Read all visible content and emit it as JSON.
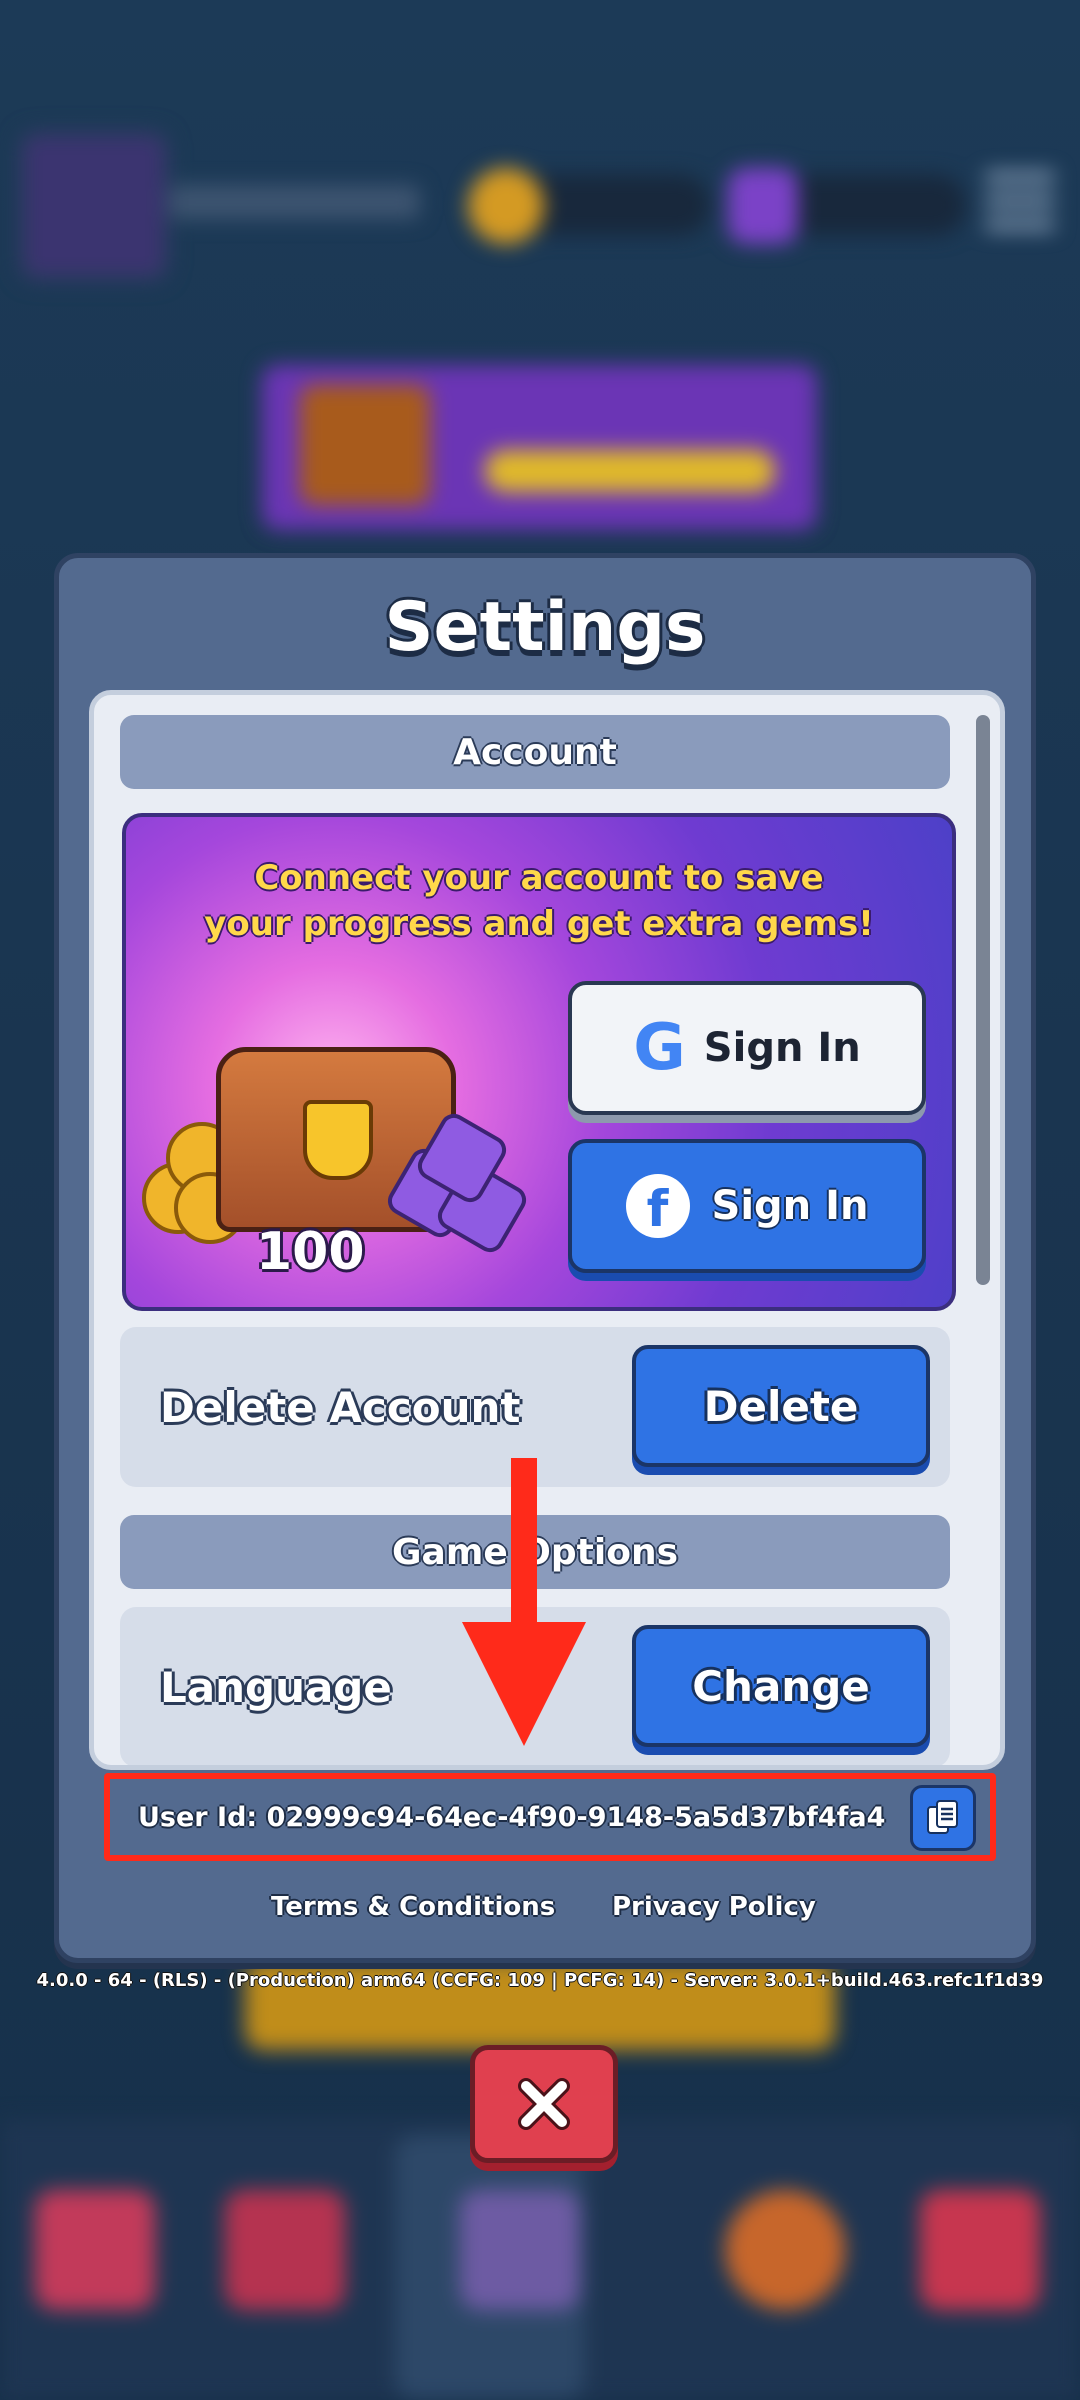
{
  "settings": {
    "title": "Settings",
    "account_header": "Account",
    "promo_text_line1": "Connect your account to save",
    "promo_text_line2": "your progress and get extra gems!",
    "google_sign_in": "Sign In",
    "facebook_sign_in": "Sign In",
    "reward_amount": "100",
    "delete_account_label": "Delete Account",
    "delete_button": "Delete",
    "game_options_header": "Game Options",
    "language_label": "Language",
    "change_button": "Change",
    "user_id": "User Id: 02999c94-64ec-4f90-9148-5a5d37bf4fa4",
    "terms_link": "Terms & Conditions",
    "privacy_link": "Privacy Policy"
  },
  "version_text": "4.0.0 - 64 - (RLS) - (Production)  arm64 (CCFG: 109 | PCFG: 14) - Server: 3.0.1+build.463.refc1f1d39",
  "colors": {
    "annotation": "#ff2a1a",
    "blue_button": "#2f73e4",
    "close_button": "#e0404f",
    "promo_text": "#ffd84a"
  },
  "icons": [
    "google-logo-icon",
    "facebook-logo-icon",
    "copy-icon",
    "close-icon",
    "chest-icon",
    "coin-icon",
    "gem-icon"
  ]
}
